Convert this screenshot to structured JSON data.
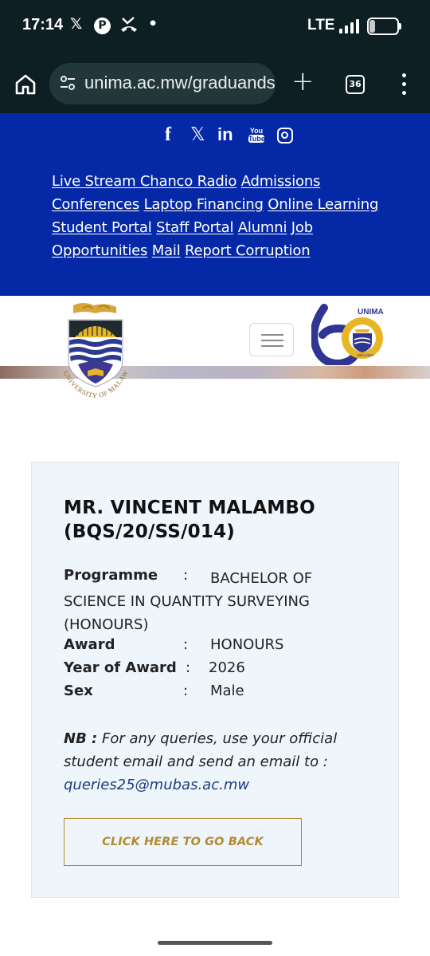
{
  "status_bar": {
    "time": "17:14",
    "network": "LTE",
    "battery": "21",
    "battery_level": 0.21,
    "icons": [
      "x-icon",
      "pinterest-icon",
      "missed-call-icon",
      "dot-icon",
      "signal-icon",
      "battery-icon"
    ]
  },
  "browser": {
    "url": "unima.ac.mw/graduands",
    "tab_count": "36",
    "icons": [
      "home-icon",
      "site-settings-icon",
      "new-tab-icon",
      "tabs-icon",
      "more-menu-icon"
    ]
  },
  "header": {
    "background": "#0529a6",
    "social": {
      "facebook": "f",
      "x": "𝕏",
      "linkedin": "in",
      "youtube_top": "You",
      "youtube_bottom": "Tube"
    },
    "links": [
      "Live Stream Chanco Radio",
      "Admissions",
      "Conferences",
      "Laptop Financing",
      "Online Learning",
      "Student Portal",
      "Staff Portal",
      "Alumni",
      "Job Opportunities",
      "Mail",
      "Report Corruption"
    ]
  },
  "logos": {
    "crest_text": "UNIVERSITY OF MALAWI",
    "anniversary_text": "UNIMA",
    "anniversary_number": "60",
    "anniversary_years": "1964 2024"
  },
  "card": {
    "name": "MR. VINCENT MALAMBO (BQS/20/SS/014)",
    "separator": ":",
    "fields": {
      "programme_label": "Programme",
      "programme_value": "BACHELOR OF SCIENCE IN QUANTITY SURVEYING (HONOURS)",
      "award_label": "Award",
      "award_value": "HONOURS",
      "year_label": "Year of Award",
      "year_value": "2026",
      "sex_label": "Sex",
      "sex_value": "Male"
    },
    "nb_label": "NB :",
    "nb_text": "For any queries, use your official student email and send an email to :",
    "nb_email": "queries25@mubas.ac.mw",
    "back_button": "CLICK HERE TO GO BACK",
    "accent": "#b38a33"
  }
}
